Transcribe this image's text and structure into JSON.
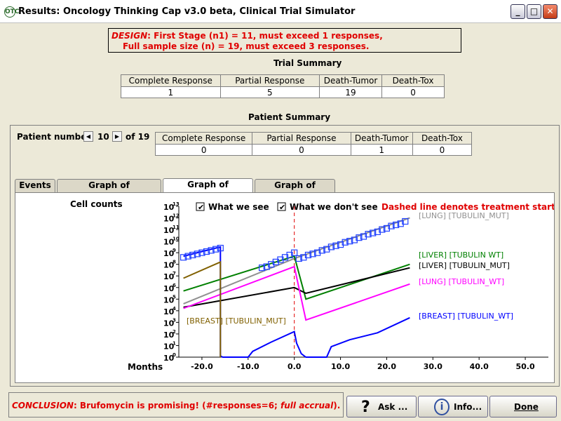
{
  "window": {
    "title": "Results: Oncology Thinking Cap v3.0 beta,  Clinical Trial Simulator",
    "icon_text": "OTC",
    "minimize": "_",
    "maximize": "□",
    "close": "✕"
  },
  "design": {
    "label": "DESIGN",
    "line1": ": First Stage (n1) = 11, must exceed 1 responses,",
    "line2": "Full sample size (n) = 19, must exceed 3 responses."
  },
  "trial_summary": {
    "title": "Trial Summary",
    "headers": [
      "Complete Response",
      "Partial Response",
      "Death-Tumor",
      "Death-Tox"
    ],
    "values": [
      "1",
      "5",
      "19",
      "0"
    ]
  },
  "patient_summary": {
    "title": "Patient Summary",
    "patient_label": "Patient number",
    "patient_value": "10",
    "of_label": "of 19",
    "headers": [
      "Complete Response",
      "Partial Response",
      "Death-Tumor",
      "Death-Tox"
    ],
    "values": [
      "0",
      "0",
      "1",
      "0"
    ]
  },
  "tabs": [
    {
      "label": "Events"
    },
    {
      "label": "Graph of concentration"
    },
    {
      "label": "Graph of cellcounts"
    },
    {
      "label": "Graph of toxicity"
    }
  ],
  "chart_data": {
    "type": "line",
    "ylabel": "Cell counts",
    "xlabel": "Months",
    "y_scale": "log10",
    "ylim": [
      1,
      10000000000000
    ],
    "xlim": [
      -25,
      55
    ],
    "x_ticks": [
      "-20.0",
      "-10.0",
      "0.0",
      "10.0",
      "20.0",
      "30.0",
      "40.0",
      "50.0"
    ],
    "y_tick_exponents": [
      "0",
      "1",
      "2",
      "3",
      "4",
      "5",
      "6",
      "7",
      "8",
      "9",
      "10",
      "11",
      "12",
      "13"
    ],
    "checkbox_what_we_see": "What we see",
    "checkbox_what_we_dont_see": "What we don't see",
    "note": "Dashed line denotes treatment start",
    "treatment_start_x": 0,
    "colors": {
      "lung_mut": "#909090",
      "liver_wt": "#008000",
      "black": "#000000",
      "lung_wt": "#ff00ff",
      "breast_wt": "#0000ff",
      "breast_mut": "#806000",
      "markers": "#2040ff",
      "treatment_line": "#e00000"
    },
    "series": [
      {
        "name": "[LUNG] [TUBULIN_MUT]",
        "color_key": "lung_mut",
        "x": [
          -24,
          0,
          25
        ],
        "y": [
          4.6,
          8.5,
          12.0
        ]
      },
      {
        "name": "[LIVER] [TUBULIN  WT]",
        "color_key": "liver_wt",
        "x": [
          -24,
          0,
          2.5,
          25
        ],
        "y": [
          5.7,
          8.7,
          5.0,
          8.0
        ]
      },
      {
        "name": "[LIVER] [TUBULIN_MUT]",
        "color_key": "black",
        "x": [
          -24,
          0,
          2.5,
          25
        ],
        "y": [
          4.3,
          6.0,
          5.5,
          7.7
        ]
      },
      {
        "name": "[LUNG] [TUBULIN_WT]",
        "color_key": "lung_wt",
        "x": [
          -24,
          0,
          2.5,
          25
        ],
        "y": [
          4.2,
          7.8,
          3.2,
          6.3
        ]
      },
      {
        "name": "[BREAST] [TUBULIN_WT]",
        "color_key": "breast_wt",
        "x": [
          -24,
          -16,
          -16,
          -15.5,
          -10,
          -9,
          -5,
          0,
          0.5,
          1.5,
          2.5,
          7,
          8,
          12,
          18,
          25
        ],
        "y": [
          8.7,
          9.5,
          0.1,
          0,
          0,
          0.5,
          1.3,
          2.2,
          1.2,
          0.3,
          0,
          0,
          0.9,
          1.5,
          2.1,
          3.4
        ]
      },
      {
        "name": "[BREAST] [TUBULIN_MUT]",
        "color_key": "breast_mut",
        "x": [
          -24,
          -16,
          -16
        ],
        "y": [
          6.8,
          8.2,
          0
        ]
      }
    ],
    "markers": {
      "x": [
        -24,
        -23,
        -22,
        -21,
        -20,
        -19,
        -18,
        -17,
        -16,
        -7,
        -6,
        -5,
        -4,
        -3,
        -2,
        -1,
        0,
        1,
        2,
        3,
        4,
        5,
        6,
        7,
        8,
        9,
        10,
        11,
        12,
        13,
        14,
        15,
        16,
        17,
        18,
        19,
        20,
        21,
        22,
        23,
        24
      ],
      "y": [
        8.6,
        8.7,
        8.8,
        8.9,
        9.0,
        9.1,
        9.2,
        9.3,
        9.4,
        7.7,
        7.8,
        8.0,
        8.2,
        8.4,
        8.6,
        8.8,
        9.0,
        8.5,
        8.6,
        8.8,
        8.9,
        9.0,
        9.2,
        9.3,
        9.5,
        9.6,
        9.7,
        9.9,
        10.0,
        10.1,
        10.3,
        10.4,
        10.6,
        10.7,
        10.8,
        11.0,
        11.1,
        11.3,
        11.4,
        11.5,
        11.7
      ]
    }
  },
  "conclusion": {
    "label": "CONCLUSION",
    "text": ": Brufomycin is promising! (#responses=6; ",
    "italic": "full accrual",
    "end": ")."
  },
  "buttons": {
    "ask": "Ask ...",
    "info": "Info...",
    "done": "Done",
    "ask_icon": "?",
    "info_icon": "i"
  }
}
